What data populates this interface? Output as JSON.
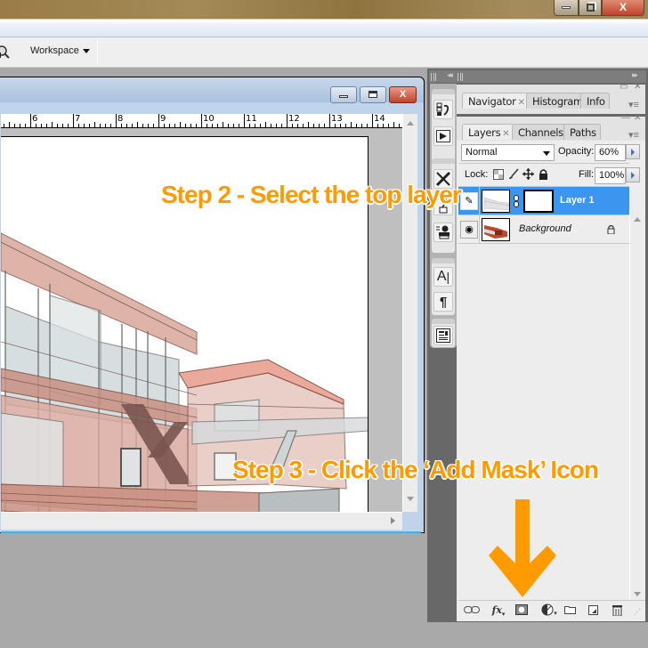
{
  "os_window": {
    "controls": {
      "minimize": "minimize",
      "restore": "restore",
      "close": "X"
    }
  },
  "options_bar": {
    "workspace_label": "Workspace"
  },
  "document": {
    "ruler_labels": [
      "6",
      "7",
      "8",
      "9",
      "10",
      "11",
      "12",
      "13",
      "14"
    ],
    "controls": {
      "close": "X"
    }
  },
  "panel_dock": {
    "collapse_label": "◂◂",
    "expand_label": "▸▸",
    "tool_icons": [
      "history-icon",
      "actions-play-icon",
      "tool-presets-icon",
      "brushes-icon",
      "clone-source-icon",
      "character-icon",
      "paragraph-icon",
      "layer-comps-icon"
    ]
  },
  "navigator_panel": {
    "tabs": [
      {
        "label": "Navigator",
        "active": true,
        "closable": true
      },
      {
        "label": "Histogram",
        "active": false
      },
      {
        "label": "Info",
        "active": false
      }
    ]
  },
  "layers_panel": {
    "tabs": [
      {
        "label": "Layers",
        "active": true,
        "closable": true
      },
      {
        "label": "Channels",
        "active": false
      },
      {
        "label": "Paths",
        "active": false
      }
    ],
    "blend_mode": "Normal",
    "opacity_label": "Opacity:",
    "opacity_value": "60%",
    "lock_label": "Lock:",
    "fill_label": "Fill:",
    "fill_value": "100%",
    "layers": [
      {
        "name": "Layer 1",
        "selected": true,
        "has_mask": true,
        "visible": true
      },
      {
        "name": "Background",
        "selected": false,
        "locked": true,
        "visible": true
      }
    ],
    "footer_buttons": [
      "link-layers",
      "add-layer-style",
      "add-layer-mask",
      "new-adjustment-layer",
      "new-group",
      "new-layer",
      "delete-layer"
    ],
    "fx_label": "fx"
  },
  "annotations": {
    "step2": "Step 2 - Select the top layer",
    "step3": "Step 3 - Click the ‘Add Mask’ Icon",
    "accent_color": "#ff9a00"
  }
}
